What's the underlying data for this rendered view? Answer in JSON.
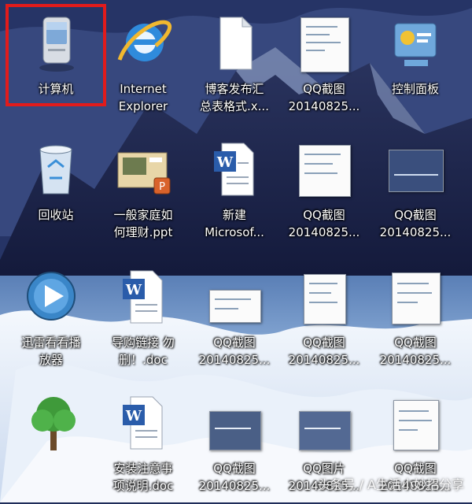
{
  "desktop": {
    "icons": [
      {
        "label": "计算机",
        "icon": "computer-icon"
      },
      {
        "label": "Internet\nExplorer",
        "label1": "Internet",
        "label2": "Explorer",
        "icon": "ie-icon"
      },
      {
        "label1": "博客发布汇",
        "label2": "总表格式.x...",
        "icon": "blank-file-icon"
      },
      {
        "label1": "QQ截图",
        "label2": "20140825...",
        "icon": "screenshot-icon"
      },
      {
        "label": "控制面板",
        "icon": "control-panel-icon"
      },
      {
        "label": "回收站",
        "icon": "recycle-bin-icon"
      },
      {
        "label1": "一般家庭如",
        "label2": "何理财.ppt",
        "icon": "ppt-file-icon"
      },
      {
        "label1": "新建",
        "label2": "Microsof...",
        "icon": "word-file-icon"
      },
      {
        "label1": "QQ截图",
        "label2": "20140825...",
        "icon": "screenshot-icon"
      },
      {
        "label1": "QQ截图",
        "label2": "20140825...",
        "icon": "screenshot-icon"
      },
      {
        "label1": "迅雷看看播",
        "label2": "放器",
        "icon": "media-player-icon"
      },
      {
        "label1": "导购链接 勿",
        "label2": "删！.doc",
        "icon": "word-file-icon"
      },
      {
        "label1": "QQ截图",
        "label2": "20140825...",
        "icon": "screenshot-icon"
      },
      {
        "label1": "QQ截图",
        "label2": "20140825...",
        "icon": "screenshot-icon"
      },
      {
        "label1": "QQ截图",
        "label2": "20140825...",
        "icon": "screenshot-icon"
      },
      {
        "label": "",
        "icon": "tree-icon"
      },
      {
        "label1": "安装注意事",
        "label2": "项说明.doc",
        "icon": "word-file-icon"
      },
      {
        "label1": "QQ截图",
        "label2": "20140825...",
        "icon": "screenshot-icon"
      },
      {
        "label1": "QQ图片",
        "label2": "20140825...",
        "icon": "screenshot-icon"
      },
      {
        "label1": "QQ截图",
        "label2": "20140825...",
        "icon": "screenshot-icon"
      }
    ]
  },
  "watermark": "头条号 / A生活小妙招分享",
  "colors": {
    "selection": "#e21b1b",
    "label_text": "#ffffff"
  }
}
